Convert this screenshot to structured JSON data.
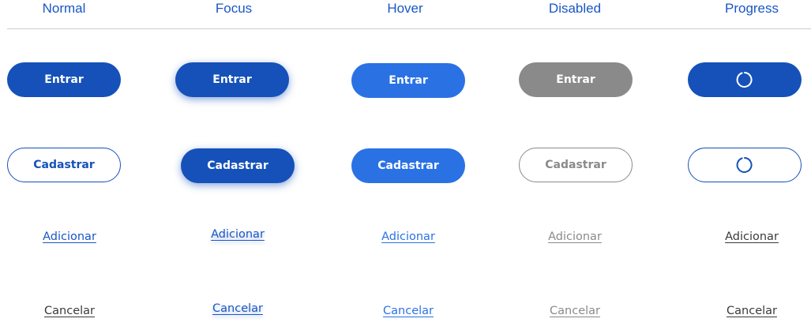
{
  "headers": [
    "Normal",
    "Focus",
    "Hover",
    "Disabled",
    "Progress"
  ],
  "primary_buttons": {
    "normal_label": "Entrar",
    "focus_label": "Entrar",
    "hover_label": "Entrar",
    "disabled_label": "Entrar"
  },
  "secondary_buttons": {
    "normal_label": "Cadastrar",
    "focus_label": "Cadastrar",
    "hover_label": "Cadastrar",
    "disabled_label": "Cadastrar"
  },
  "add_links": {
    "normal_label": "Adicionar",
    "focus_label": "Adicionar",
    "hover_label": "Adicionar",
    "disabled_label": "Adicionar",
    "progress_label": "Adicionar"
  },
  "cancel_links": {
    "normal_label": "Cancelar",
    "focus_label": "Cancelar",
    "hover_label": "Cancelar",
    "disabled_label": "Cancelar",
    "progress_label": "Cancelar"
  },
  "colors": {
    "primary": "#1651b9",
    "hover": "#2a72e4",
    "disabled": "#8a8a8a",
    "header_text": "#1a56c4",
    "divider": "#cccccc"
  },
  "icons": {
    "progress_primary": "spinner-icon",
    "progress_secondary": "spinner-icon"
  }
}
